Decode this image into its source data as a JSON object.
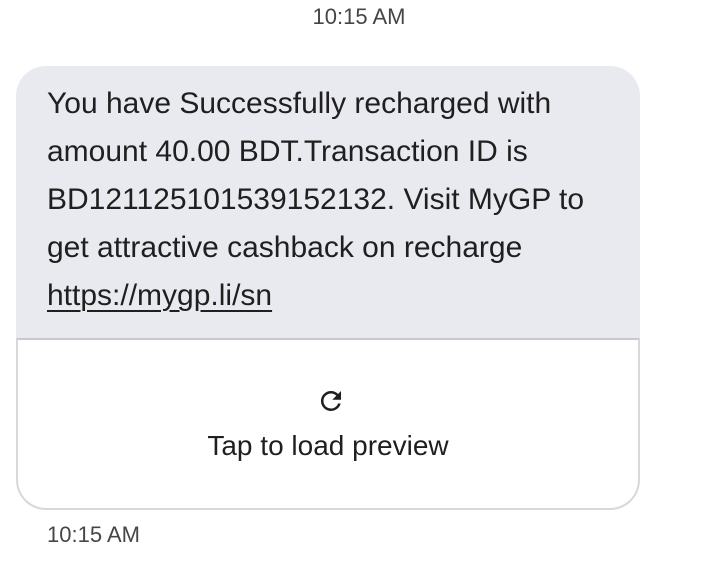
{
  "conversation": {
    "timestamp_top": "10:15 AM",
    "message": {
      "text": "You have Successfully recharged with amount 40.00 BDT.Transaction ID is BD121125101539152132. Visit MyGP to get attractive cashback on recharge",
      "link": "https://mygp.li/sn"
    },
    "preview": {
      "icon": "refresh-icon",
      "label": "Tap to load preview"
    },
    "timestamp_bottom": "10:15 AM"
  }
}
